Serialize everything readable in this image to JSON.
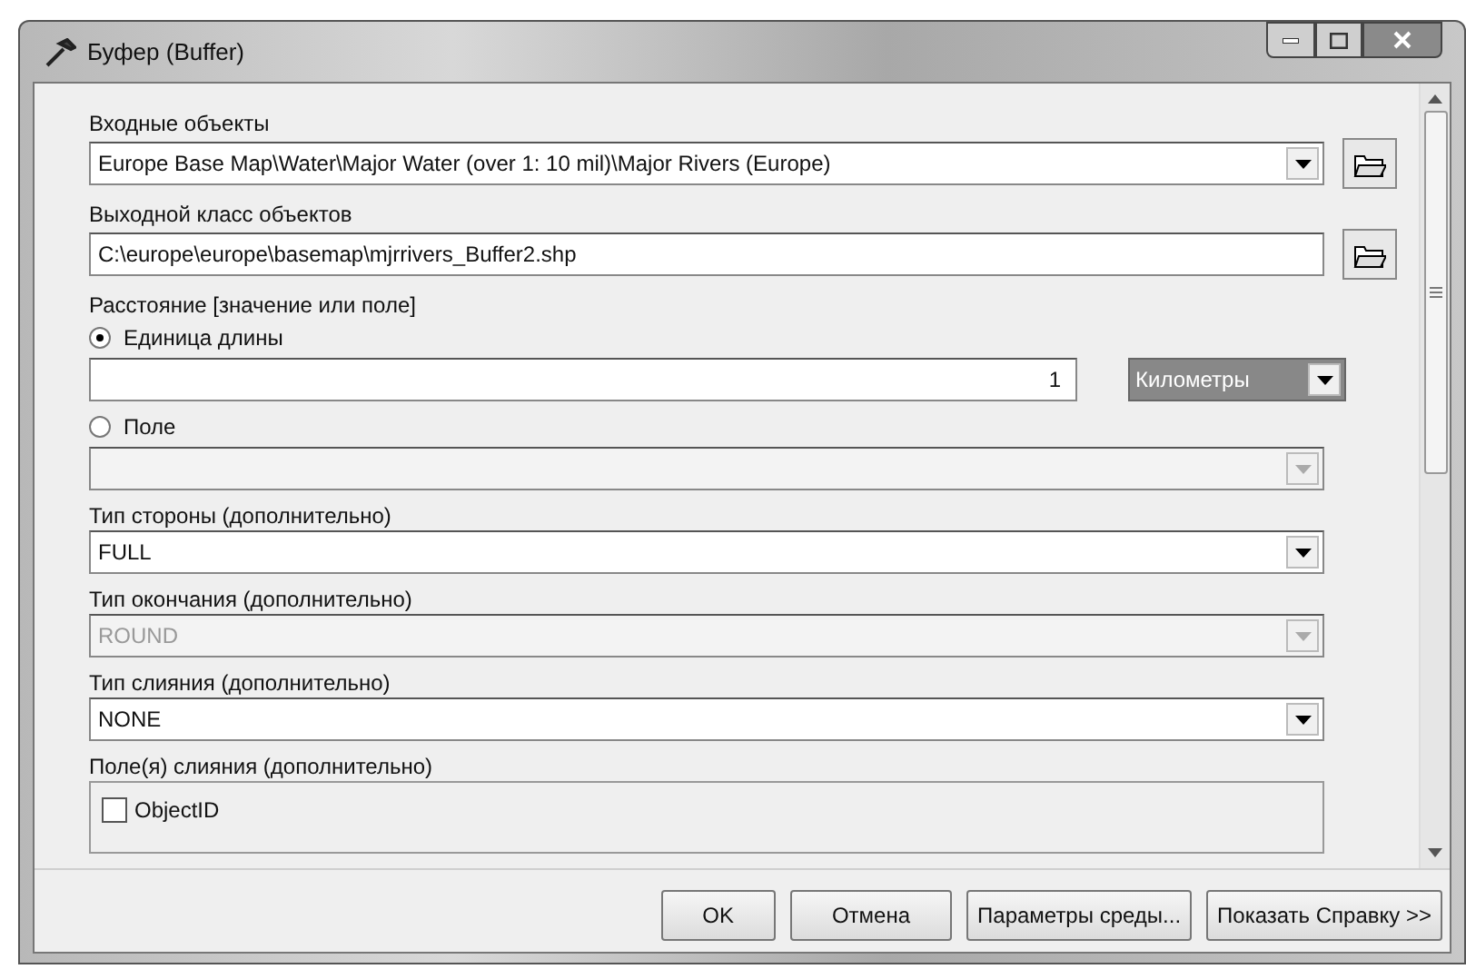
{
  "window": {
    "title": "Буфер (Buffer)"
  },
  "params": [
    {
      "kind": "combo",
      "label": "Входные объекты",
      "value": "Europe Base Map\\Water\\Major Water (over 1: 10 mil)\\Major Rivers (Europe)",
      "browse": true,
      "disabled": false
    },
    {
      "kind": "text",
      "label": "Выходной класс объектов",
      "value": "C:\\europe\\europe\\basemap\\mjrrivers_Buffer2.shp",
      "browse": true
    },
    {
      "kind": "heading",
      "label": "Расстояние [значение или поле]"
    },
    {
      "kind": "radio",
      "label": "Единица длины",
      "selected": true
    },
    {
      "kind": "unit",
      "value": "1",
      "unit": "Километры"
    },
    {
      "kind": "radio",
      "label": "Поле",
      "selected": false
    },
    {
      "kind": "combo",
      "disabled": true
    },
    {
      "kind": "combo",
      "label": "Тип стороны (дополнительно)",
      "value": "FULL",
      "disabled": false
    },
    {
      "kind": "combo",
      "label": "Тип окончания (дополнительно)",
      "value": "ROUND",
      "disabled": true
    },
    {
      "kind": "combo",
      "label": "Тип слияния (дополнительно)",
      "value": "NONE",
      "disabled": false
    },
    {
      "kind": "checklist",
      "label": "Поле(я) слияния (дополнительно)",
      "items": [
        {
          "label": "ObjectID",
          "checked": false
        }
      ]
    }
  ],
  "buttons": [
    {
      "label": "OK"
    },
    {
      "label": "Отмена"
    },
    {
      "label": "Параметры среды..."
    },
    {
      "label": "Показать Справку >>"
    }
  ]
}
